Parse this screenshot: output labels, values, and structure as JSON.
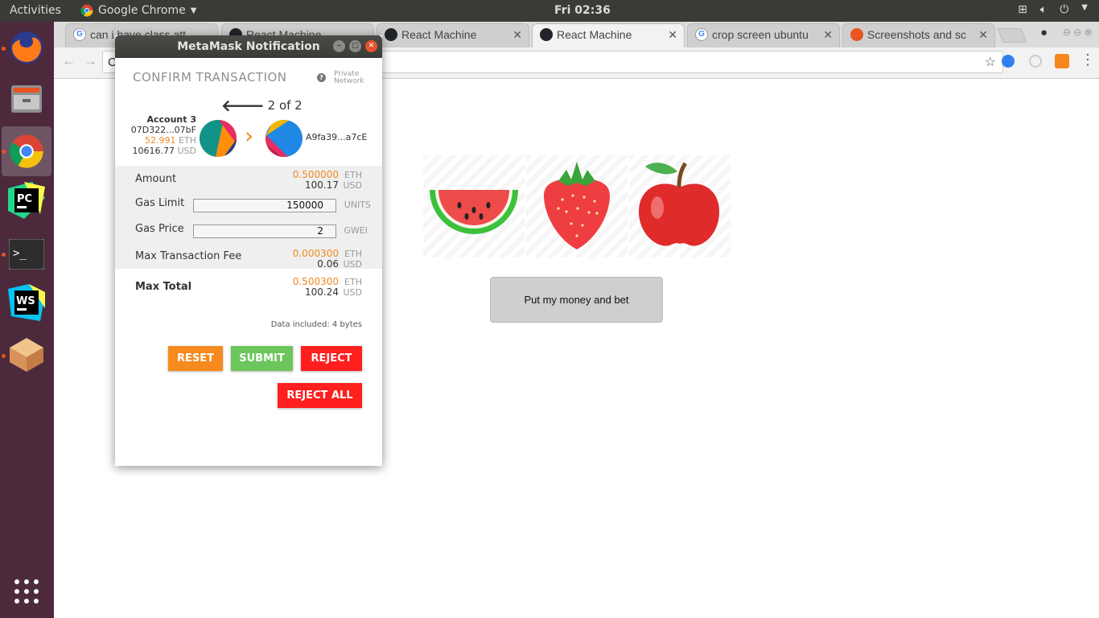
{
  "topbar": {
    "activities": "Activities",
    "app_name": "Google Chrome",
    "clock": "Fri 02:36"
  },
  "browser": {
    "tabs": [
      {
        "title": "can i have class att"
      },
      {
        "title": "React Machine"
      },
      {
        "title": "React Machine"
      },
      {
        "title": "React Machine"
      },
      {
        "title": "crop screen ubuntu"
      },
      {
        "title": "Screenshots and sc"
      }
    ],
    "address_prefix": "C"
  },
  "page": {
    "bet_button": "Put my money and bet"
  },
  "metamask": {
    "window_title": "MetaMask Notification",
    "header": "CONFIRM TRANSACTION",
    "network_line1": "Private",
    "network_line2": "Network",
    "counter": "2 of 2",
    "account": {
      "name": "Account 3",
      "address": "07D322...07bF",
      "eth_balance": "52.991",
      "eth_unit": "ETH",
      "usd_balance": "10616.77",
      "usd_unit": "USD"
    },
    "recipient": "A9fa39...a7cE",
    "amount": {
      "label": "Amount",
      "eth": "0.500000",
      "eth_unit": "ETH",
      "usd": "100.17",
      "usd_unit": "USD"
    },
    "gas_limit": {
      "label": "Gas Limit",
      "value": "150000",
      "unit": "UNITS"
    },
    "gas_price": {
      "label": "Gas Price",
      "value": "2",
      "unit": "GWEI"
    },
    "max_fee": {
      "label": "Max Transaction Fee",
      "eth": "0.000300",
      "eth_unit": "ETH",
      "usd": "0.06",
      "usd_unit": "USD"
    },
    "max_total": {
      "label": "Max Total",
      "eth": "0.500300",
      "eth_unit": "ETH",
      "usd": "100.24",
      "usd_unit": "USD"
    },
    "data_included": "Data included: 4 bytes",
    "buttons": {
      "reset": "RESET",
      "submit": "SUBMIT",
      "reject": "REJECT",
      "reject_all": "REJECT ALL"
    },
    "colors": {
      "orange": "#f08a24",
      "reset": "#f78a1e",
      "submit": "#6cc65c",
      "reject": "#ff1f1f"
    }
  }
}
